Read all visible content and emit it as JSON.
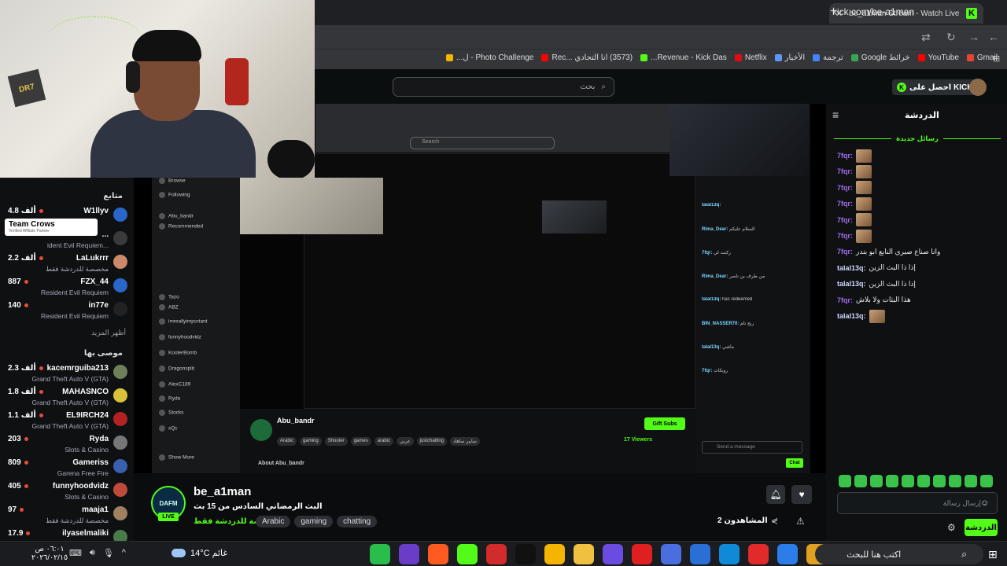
{
  "browser": {
    "tab_title": "be_a1man Stream - Watch Live",
    "url": "kick.com/be-a1man",
    "bookmarks": [
      {
        "label": "Gmail",
        "color": "#ea4335"
      },
      {
        "label": "YouTube",
        "color": "#ff0000"
      },
      {
        "label": "خرائط Google",
        "color": "#34a853"
      },
      {
        "label": "ترجمة",
        "color": "#4285f4"
      },
      {
        "label": "الأخبار",
        "color": "#5e97f6"
      },
      {
        "label": "Netflix",
        "color": "#e50914"
      },
      {
        "label": "Revenue - Kick Das...",
        "color": "#53fc18"
      },
      {
        "label": "(3573) انا التحادي ...Rec",
        "color": "#ff0000"
      },
      {
        "label": "Photo Challenge - ل...",
        "color": "#f4b400"
      }
    ]
  },
  "kick": {
    "search_placeholder": "بحث",
    "get_kicks": "احصل على KICKs"
  },
  "webcam": {
    "sign_text": "DR7"
  },
  "sidebar": {
    "following_heading": "متابع",
    "following": [
      {
        "name": "W1llyv",
        "count": "4.8 ألف",
        "game": "",
        "avatar": "#2a66c7",
        "live": "red"
      },
      {
        "name": "...",
        "count": "",
        "game": "...ident Evil Requiem",
        "avatar": "#3a3a3a",
        "live": "red"
      },
      {
        "name": "LaLukrrr",
        "count": "2.2 ألف",
        "game": "مخصصة للدردشة فقط",
        "avatar": "#cc8a6a",
        "live": "red"
      },
      {
        "name": "FZX_44",
        "count": "887",
        "game": "Resident Evil Requiem",
        "avatar": "#2a66c7",
        "live": "red"
      },
      {
        "name": "in77e",
        "count": "140",
        "game": "Resident Evil Requiem",
        "avatar": "#222222",
        "live": "red"
      }
    ],
    "tooltip_title": "Team Crows",
    "tooltip_sub": "Verified Affiliate Partner",
    "show_more": "أظهر المزيد",
    "recommended_heading": "موصى بها",
    "recommended": [
      {
        "name": "kacemrguiba213",
        "count": "2.3 ألف",
        "game": "Grand Theft Auto V (GTA)",
        "avatar": "#6f7f5a"
      },
      {
        "name": "MAHASNCO",
        "count": "1.8 ألف",
        "game": "Grand Theft Auto V (GTA)",
        "avatar": "#d9c23a"
      },
      {
        "name": "EL9IRCH24",
        "count": "1.1 ألف",
        "game": "Grand Theft Auto V (GTA)",
        "avatar": "#b22222"
      },
      {
        "name": "Ryda",
        "count": "203",
        "game": "Slots & Casino",
        "avatar": "#777777"
      },
      {
        "name": "Gameriss",
        "count": "809",
        "game": "Garena Free Fire",
        "avatar": "#3a5fb0"
      },
      {
        "name": "funnyhoodvidz",
        "count": "405",
        "game": "Slots & Casino",
        "avatar": "#c04a3a"
      },
      {
        "name": "maaja1",
        "count": "97",
        "game": "مخصصة للدردشة فقط",
        "avatar": "#a08060"
      },
      {
        "name": "ilyaselmaliki",
        "count": "17.9",
        "game": "",
        "avatar": "#4a7a4a"
      }
    ]
  },
  "nested": {
    "search": "Search",
    "streamer": "Abu_bandr",
    "gift_subs": "Gift Subs",
    "viewers": "17 Viewers",
    "tags": [
      "Arabic",
      "gaming",
      "Shooter",
      "games",
      "arabic",
      "عربي",
      "justchatting",
      "سايبر ساهاد"
    ],
    "about": "About Abu_bandr",
    "send_message": "Send a message",
    "chat_button": "Chat",
    "left_items": [
      "Browse",
      "Following",
      "Abu_bandr",
      "Recommended",
      "Tazo",
      "ABZ",
      "imreallyimportant",
      "funnyhoodvidz",
      "KooterBomb",
      "Dragonsplit",
      "AlexC189",
      "Ryda",
      "Stocks",
      "xQc",
      "Show More"
    ],
    "chat_lines": [
      {
        "user": "talal13q:",
        "msg": ""
      },
      {
        "user": "Rima_Dear:",
        "msg": "السلام عليكم"
      },
      {
        "user": "7fqr:",
        "msg": "ركبت لي"
      },
      {
        "user": "Rima_Dear:",
        "msg": "من طرف بن ناصر"
      },
      {
        "user": "talal13q:",
        "msg": "has redeemed"
      },
      {
        "user": "BIN_NASSER70:",
        "msg": "ربح تام"
      },
      {
        "user": "talal13q:",
        "msg": "ماشي"
      },
      {
        "user": "7fqr:",
        "msg": "روبكات"
      }
    ]
  },
  "chat": {
    "title": "الدردشة",
    "new_messages": "رسائل جديدة",
    "messages": [
      {
        "user": "7fqr:",
        "color": "#a06cf0",
        "msg": "",
        "emote": true
      },
      {
        "user": "7fqr:",
        "color": "#a06cf0",
        "msg": "",
        "emote": true
      },
      {
        "user": "7fqr:",
        "color": "#a06cf0",
        "msg": "",
        "emote": true
      },
      {
        "user": "7fqr:",
        "color": "#a06cf0",
        "msg": "",
        "emote": true
      },
      {
        "user": "7fqr:",
        "color": "#a06cf0",
        "msg": "",
        "emote": true
      },
      {
        "user": "7fqr:",
        "color": "#a06cf0",
        "msg": "",
        "emote": true
      },
      {
        "user": "7fqr:",
        "color": "#a06cf0",
        "msg": "وانا صناع صبري النابع ابو بندر",
        "emote": false
      },
      {
        "user": "talal13q:",
        "color": "#cfd7ff",
        "msg": "إذا ذا البث الزين",
        "emote": false
      },
      {
        "user": "talal13q:",
        "color": "#cfd7ff",
        "msg": "إذا ذا البث الزين",
        "emote": false
      },
      {
        "user": "7fqr:",
        "color": "#a06cf0",
        "msg": "هذا البثات ولا بلاش",
        "emote": false
      },
      {
        "user": "talal13q:",
        "color": "#cfd7ff",
        "msg": "",
        "emote": true
      }
    ],
    "input_placeholder": "إرسال رسالة",
    "chat_button": "الدردشة"
  },
  "stream": {
    "avatar_text": "DAFM",
    "live_badge": "LIVE",
    "name": "be_a1man",
    "title": "البث الرمضاني السادس من 15 بث",
    "category": "مخصصة للدردشة فقط",
    "tags": [
      "Arabic",
      "gaming",
      "chatting"
    ],
    "viewers_label": "المشاهدون 2"
  },
  "taskbar": {
    "search_placeholder": "اكتب هنا للبحث",
    "weather": "14°C غائم",
    "time": "٠٦:٠١ ص",
    "date": "٢٠٢٦/٠٢/١٥",
    "app_colors": [
      "#2bbd4c",
      "#6a3cc7",
      "#ff5a1f",
      "#53fc18",
      "#d22b2b",
      "#111111",
      "#f4b400",
      "#f0c040",
      "#6c4ce0",
      "#e02020",
      "#4a6ee0",
      "#2a6fd6",
      "#0f8ad8",
      "#e12a2a",
      "#2b7de9",
      "#e0a020"
    ]
  }
}
